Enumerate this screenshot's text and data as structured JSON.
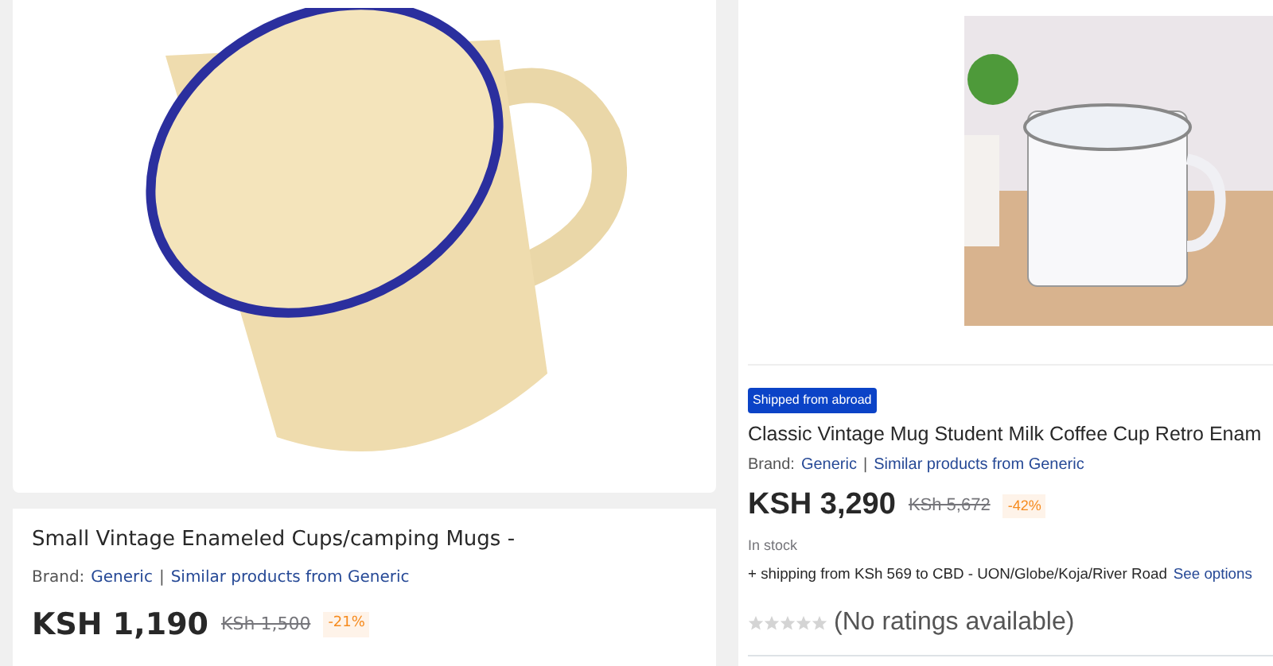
{
  "left_product": {
    "title": "Small Vintage Enameled Cups/camping Mugs -",
    "brand_label": "Brand:",
    "brand": "Generic",
    "separator": "|",
    "similar_link": "Similar products from Generic",
    "price": "KSH 1,190",
    "old_price": "KSh 1,500",
    "discount": "-21%"
  },
  "right_product": {
    "badge": "Shipped from abroad",
    "title": "Classic Vintage Mug Student Milk Coffee Cup Retro  Enam",
    "brand_label": "Brand:",
    "brand": "Generic",
    "separator": "|",
    "similar_link": "Similar products from Generic",
    "price": "KSH 3,290",
    "old_price": "KSh 5,672",
    "discount": "-42%",
    "stock": "In stock",
    "shipping": "+ shipping from KSh 569 to CBD - UON/Globe/Koja/River Road",
    "shipping_link": "See options",
    "stars": 0,
    "ratings": "(No ratings available)"
  }
}
